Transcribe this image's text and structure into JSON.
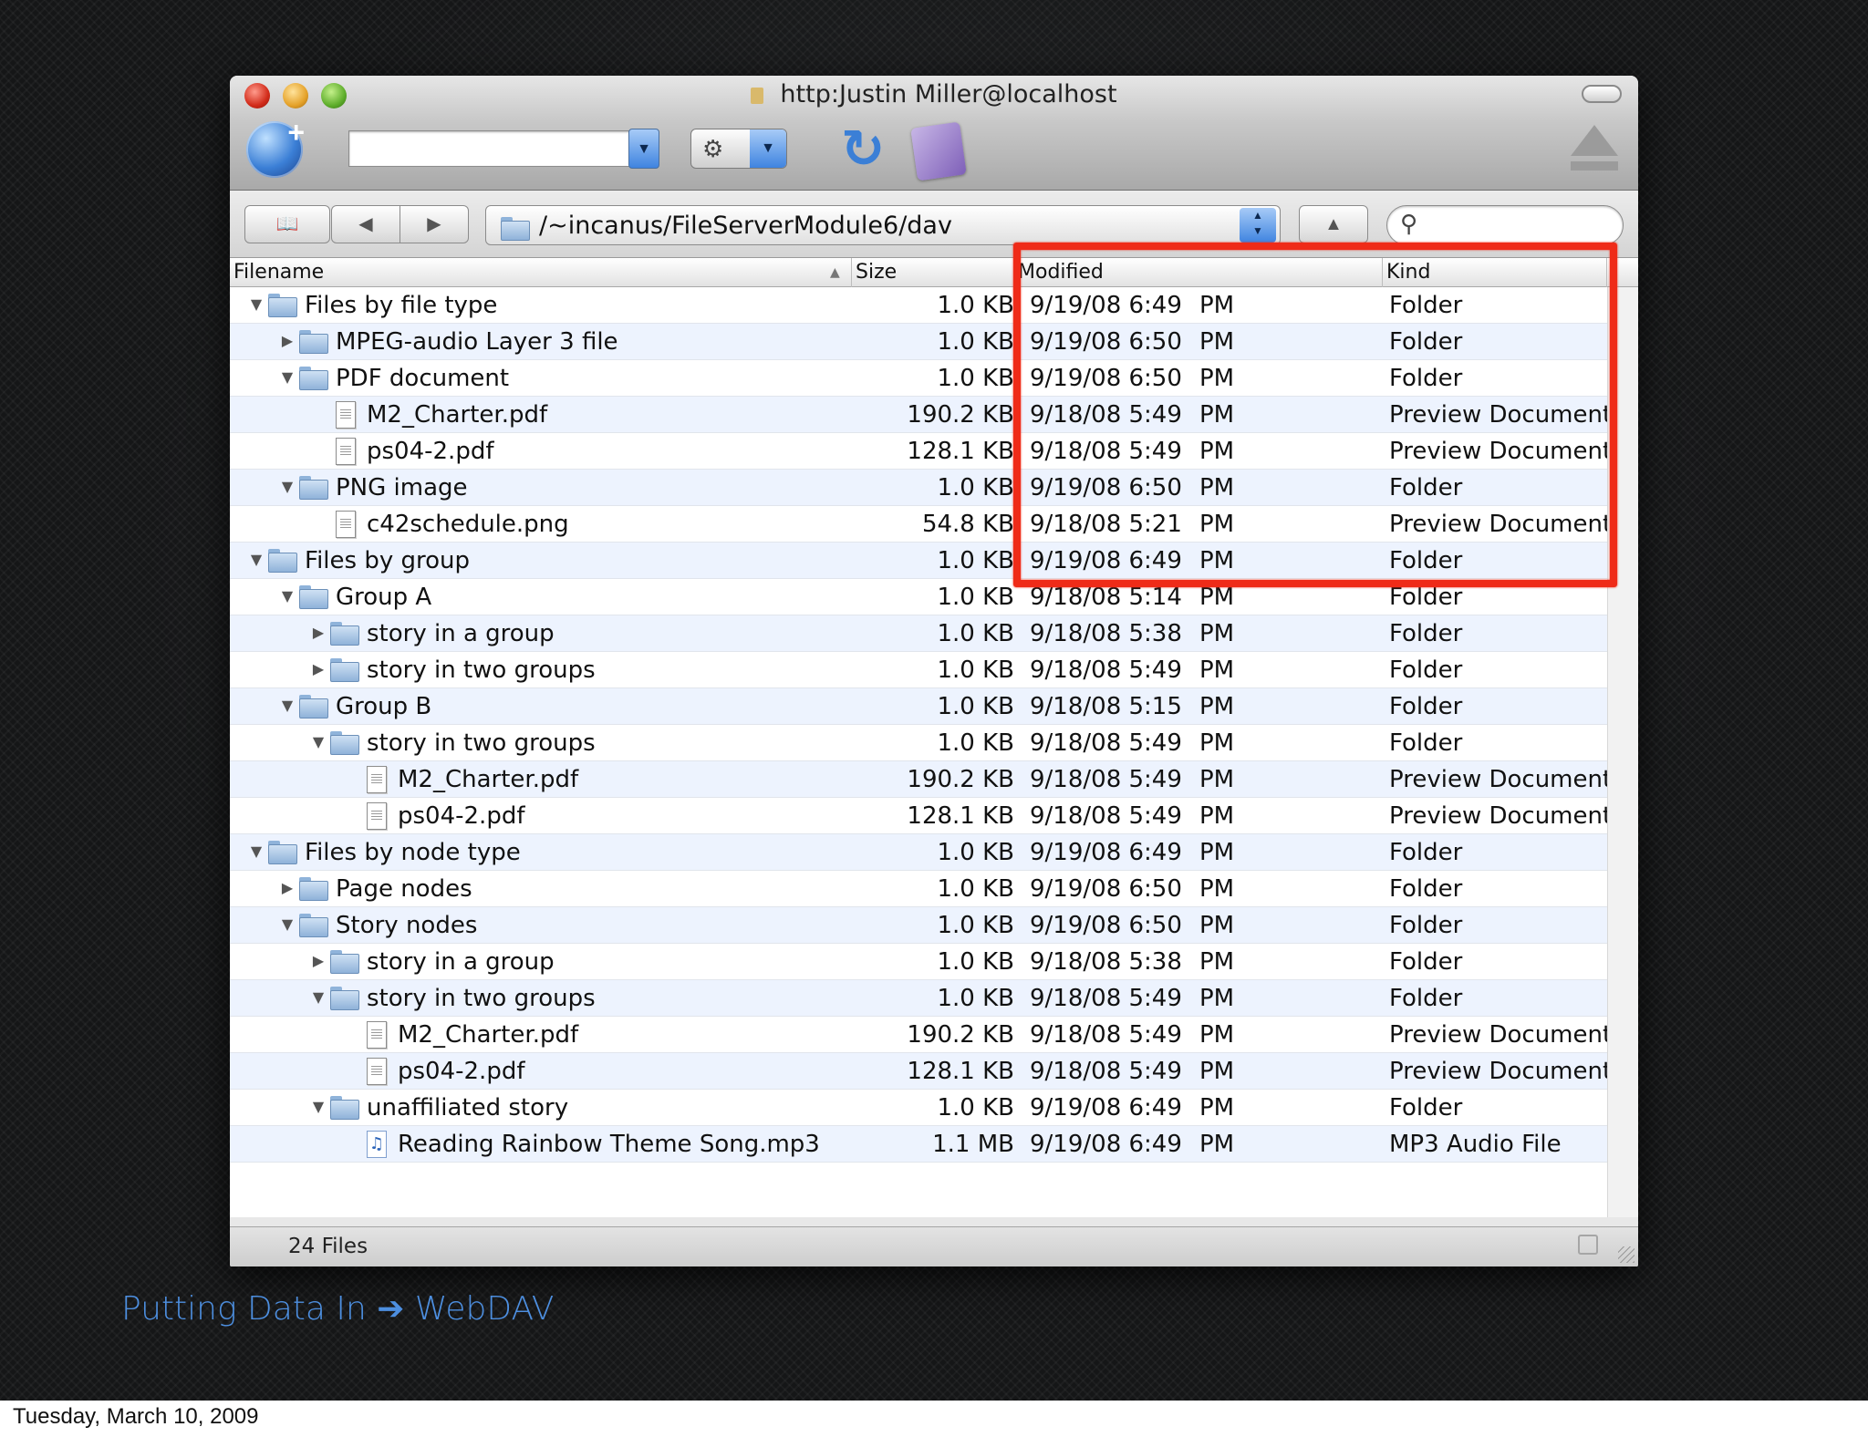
{
  "window": {
    "title": "http:Justin Miller@localhost"
  },
  "navigation": {
    "path": "/~incanus/FileServerModule6/dav"
  },
  "columns": {
    "filename": "Filename",
    "size": "Size",
    "modified": "Modified",
    "kind": "Kind"
  },
  "rows": [
    {
      "level": 0,
      "disclosure": "open",
      "icon": "folder",
      "name": "Files by file type",
      "size": "1.0 KB",
      "modified": "9/19/08 6:49",
      "ampm": "PM",
      "kind": "Folder"
    },
    {
      "level": 1,
      "disclosure": "closed",
      "icon": "folder",
      "name": "MPEG-audio Layer 3 file",
      "size": "1.0 KB",
      "modified": "9/19/08 6:50",
      "ampm": "PM",
      "kind": "Folder"
    },
    {
      "level": 1,
      "disclosure": "open",
      "icon": "folder",
      "name": "PDF document",
      "size": "1.0 KB",
      "modified": "9/19/08 6:50",
      "ampm": "PM",
      "kind": "Folder"
    },
    {
      "level": 2,
      "disclosure": "none",
      "icon": "document",
      "name": "M2_Charter.pdf",
      "size": "190.2 KB",
      "modified": "9/18/08 5:49",
      "ampm": "PM",
      "kind": "Preview Document"
    },
    {
      "level": 2,
      "disclosure": "none",
      "icon": "document",
      "name": "ps04-2.pdf",
      "size": "128.1 KB",
      "modified": "9/18/08 5:49",
      "ampm": "PM",
      "kind": "Preview Document"
    },
    {
      "level": 1,
      "disclosure": "open",
      "icon": "folder",
      "name": "PNG image",
      "size": "1.0 KB",
      "modified": "9/19/08 6:50",
      "ampm": "PM",
      "kind": "Folder"
    },
    {
      "level": 2,
      "disclosure": "none",
      "icon": "document",
      "name": "c42schedule.png",
      "size": "54.8 KB",
      "modified": "9/18/08 5:21",
      "ampm": "PM",
      "kind": "Preview Document"
    },
    {
      "level": 0,
      "disclosure": "open",
      "icon": "folder",
      "name": "Files by group",
      "size": "1.0 KB",
      "modified": "9/19/08 6:49",
      "ampm": "PM",
      "kind": "Folder"
    },
    {
      "level": 1,
      "disclosure": "open",
      "icon": "folder",
      "name": "Group A",
      "size": "1.0 KB",
      "modified": "9/18/08 5:14",
      "ampm": "PM",
      "kind": "Folder"
    },
    {
      "level": 2,
      "disclosure": "closed",
      "icon": "folder",
      "name": "story in a group",
      "size": "1.0 KB",
      "modified": "9/18/08 5:38",
      "ampm": "PM",
      "kind": "Folder"
    },
    {
      "level": 2,
      "disclosure": "closed",
      "icon": "folder",
      "name": "story in two groups",
      "size": "1.0 KB",
      "modified": "9/18/08 5:49",
      "ampm": "PM",
      "kind": "Folder"
    },
    {
      "level": 1,
      "disclosure": "open",
      "icon": "folder",
      "name": "Group B",
      "size": "1.0 KB",
      "modified": "9/18/08 5:15",
      "ampm": "PM",
      "kind": "Folder"
    },
    {
      "level": 2,
      "disclosure": "open",
      "icon": "folder",
      "name": "story in two groups",
      "size": "1.0 KB",
      "modified": "9/18/08 5:49",
      "ampm": "PM",
      "kind": "Folder"
    },
    {
      "level": 3,
      "disclosure": "none",
      "icon": "document",
      "name": "M2_Charter.pdf",
      "size": "190.2 KB",
      "modified": "9/18/08 5:49",
      "ampm": "PM",
      "kind": "Preview Document"
    },
    {
      "level": 3,
      "disclosure": "none",
      "icon": "document",
      "name": "ps04-2.pdf",
      "size": "128.1 KB",
      "modified": "9/18/08 5:49",
      "ampm": "PM",
      "kind": "Preview Document"
    },
    {
      "level": 0,
      "disclosure": "open",
      "icon": "folder",
      "name": "Files by node type",
      "size": "1.0 KB",
      "modified": "9/19/08 6:49",
      "ampm": "PM",
      "kind": "Folder"
    },
    {
      "level": 1,
      "disclosure": "closed",
      "icon": "folder",
      "name": "Page nodes",
      "size": "1.0 KB",
      "modified": "9/19/08 6:50",
      "ampm": "PM",
      "kind": "Folder"
    },
    {
      "level": 1,
      "disclosure": "open",
      "icon": "folder",
      "name": "Story nodes",
      "size": "1.0 KB",
      "modified": "9/19/08 6:50",
      "ampm": "PM",
      "kind": "Folder"
    },
    {
      "level": 2,
      "disclosure": "closed",
      "icon": "folder",
      "name": "story in a group",
      "size": "1.0 KB",
      "modified": "9/18/08 5:38",
      "ampm": "PM",
      "kind": "Folder"
    },
    {
      "level": 2,
      "disclosure": "open",
      "icon": "folder",
      "name": "story in two groups",
      "size": "1.0 KB",
      "modified": "9/18/08 5:49",
      "ampm": "PM",
      "kind": "Folder"
    },
    {
      "level": 3,
      "disclosure": "none",
      "icon": "document",
      "name": "M2_Charter.pdf",
      "size": "190.2 KB",
      "modified": "9/18/08 5:49",
      "ampm": "PM",
      "kind": "Preview Document"
    },
    {
      "level": 3,
      "disclosure": "none",
      "icon": "document",
      "name": "ps04-2.pdf",
      "size": "128.1 KB",
      "modified": "9/18/08 5:49",
      "ampm": "PM",
      "kind": "Preview Document"
    },
    {
      "level": 2,
      "disclosure": "open",
      "icon": "folder",
      "name": "unaffiliated story",
      "size": "1.0 KB",
      "modified": "9/19/08 6:49",
      "ampm": "PM",
      "kind": "Folder"
    },
    {
      "level": 3,
      "disclosure": "none",
      "icon": "audio",
      "name": "Reading Rainbow Theme Song.mp3",
      "size": "1.1 MB",
      "modified": "9/19/08 6:49",
      "ampm": "PM",
      "kind": "MP3 Audio File"
    }
  ],
  "status": {
    "file_count": "24 Files"
  },
  "slide": {
    "caption": "Putting Data In ➔ WebDAV",
    "date": "Tuesday, March 10, 2009",
    "highlight_color": "#ef2b18",
    "caption_color": "#4d8fe0"
  }
}
